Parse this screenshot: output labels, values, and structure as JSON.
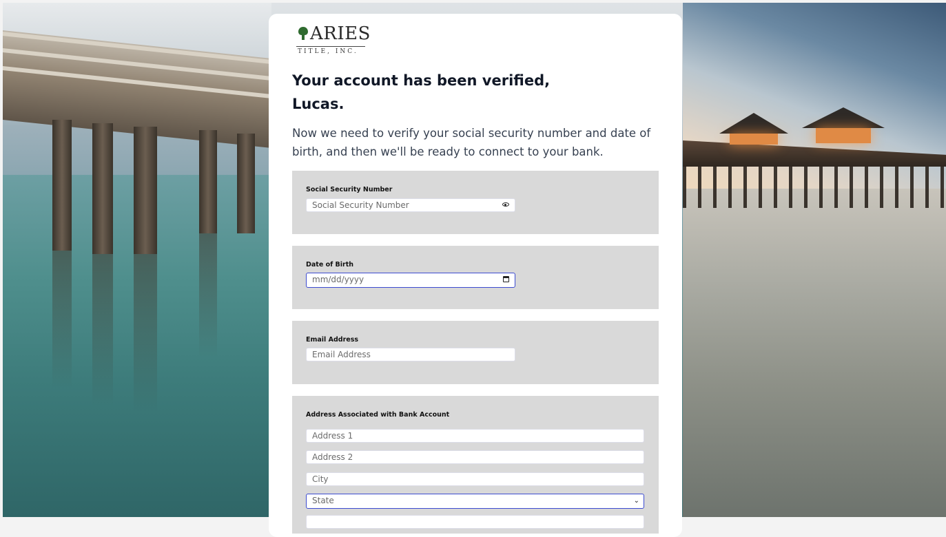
{
  "brand": {
    "logo_name": "ARIES",
    "logo_tagline": "TITLE, INC."
  },
  "heading": {
    "line1": "Your account has been verified,",
    "line2": "Lucas."
  },
  "intro": "Now we need to verify your social security number and date of birth, and then we'll be ready to connect to your bank.",
  "ssn": {
    "label": "Social Security Number",
    "placeholder": "Social Security Number",
    "toggle_icon": "eye-icon"
  },
  "dob": {
    "label": "Date of Birth",
    "placeholder": "mm/dd/yyyy",
    "picker_icon": "calendar-icon"
  },
  "email": {
    "label": "Email Address",
    "placeholder": "Email Address"
  },
  "address": {
    "label": "Address Associated with Bank Account",
    "address1_placeholder": "Address 1",
    "address2_placeholder": "Address 2",
    "city_placeholder": "City",
    "state_selected": "State"
  },
  "colors": {
    "panel_bg": "#d9d9d9",
    "focus_border": "#3b4ad0",
    "heading_text": "#111827"
  }
}
